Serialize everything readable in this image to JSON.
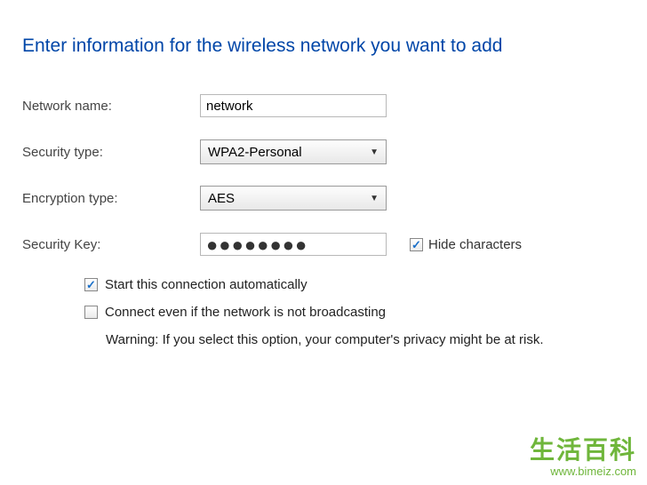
{
  "header": {
    "title": "Enter information for the wireless network you want to add"
  },
  "form": {
    "network_name_label": "Network name:",
    "network_name_value": "network",
    "security_type_label": "Security type:",
    "security_type_value": "WPA2-Personal",
    "encryption_type_label": "Encryption type:",
    "encryption_type_value": "AES",
    "security_key_label": "Security Key:",
    "security_key_value": "●●●●●●●●",
    "hide_characters_label": "Hide characters",
    "hide_characters_checked": true,
    "start_auto_label": "Start this connection automatically",
    "start_auto_checked": true,
    "connect_hidden_label": "Connect even if the network is not broadcasting",
    "connect_hidden_checked": false,
    "warning_text": "Warning: If you select this option, your computer's privacy might be at risk."
  },
  "watermark": {
    "text": "生活百科",
    "url": "www.bimeiz.com"
  }
}
